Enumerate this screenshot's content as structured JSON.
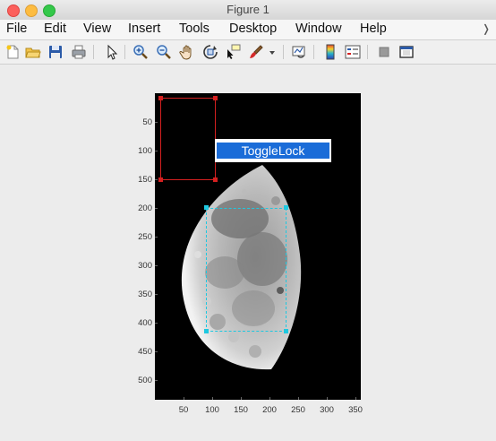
{
  "window": {
    "title": "Figure 1"
  },
  "menubar": {
    "items": [
      "File",
      "Edit",
      "View",
      "Insert",
      "Tools",
      "Desktop",
      "Window",
      "Help"
    ],
    "overflow_icon": "chevron-right-icon"
  },
  "toolbar": {
    "icons": [
      "new-figure-icon",
      "open-file-icon",
      "save-icon",
      "print-icon",
      "pointer-icon",
      "zoom-in-icon",
      "zoom-out-icon",
      "pan-icon",
      "rotate-3d-icon",
      "data-cursor-icon",
      "brush-icon",
      "brush-dropdown-icon",
      "link-plot-icon",
      "colorbar-icon",
      "legend-icon",
      "hide-plot-tools-icon",
      "show-plot-tools-icon"
    ]
  },
  "axes": {
    "yticks": [
      "50",
      "100",
      "150",
      "200",
      "250",
      "300",
      "350",
      "400",
      "450",
      "500"
    ],
    "xticks": [
      "50",
      "100",
      "150",
      "200",
      "250",
      "300",
      "350"
    ]
  },
  "context_menu": {
    "items": [
      "ToggleLock"
    ]
  },
  "colors": {
    "roi_locked": "#d42020",
    "roi_active": "#1ec8e0",
    "menu_highlight": "#1a6cd8"
  }
}
